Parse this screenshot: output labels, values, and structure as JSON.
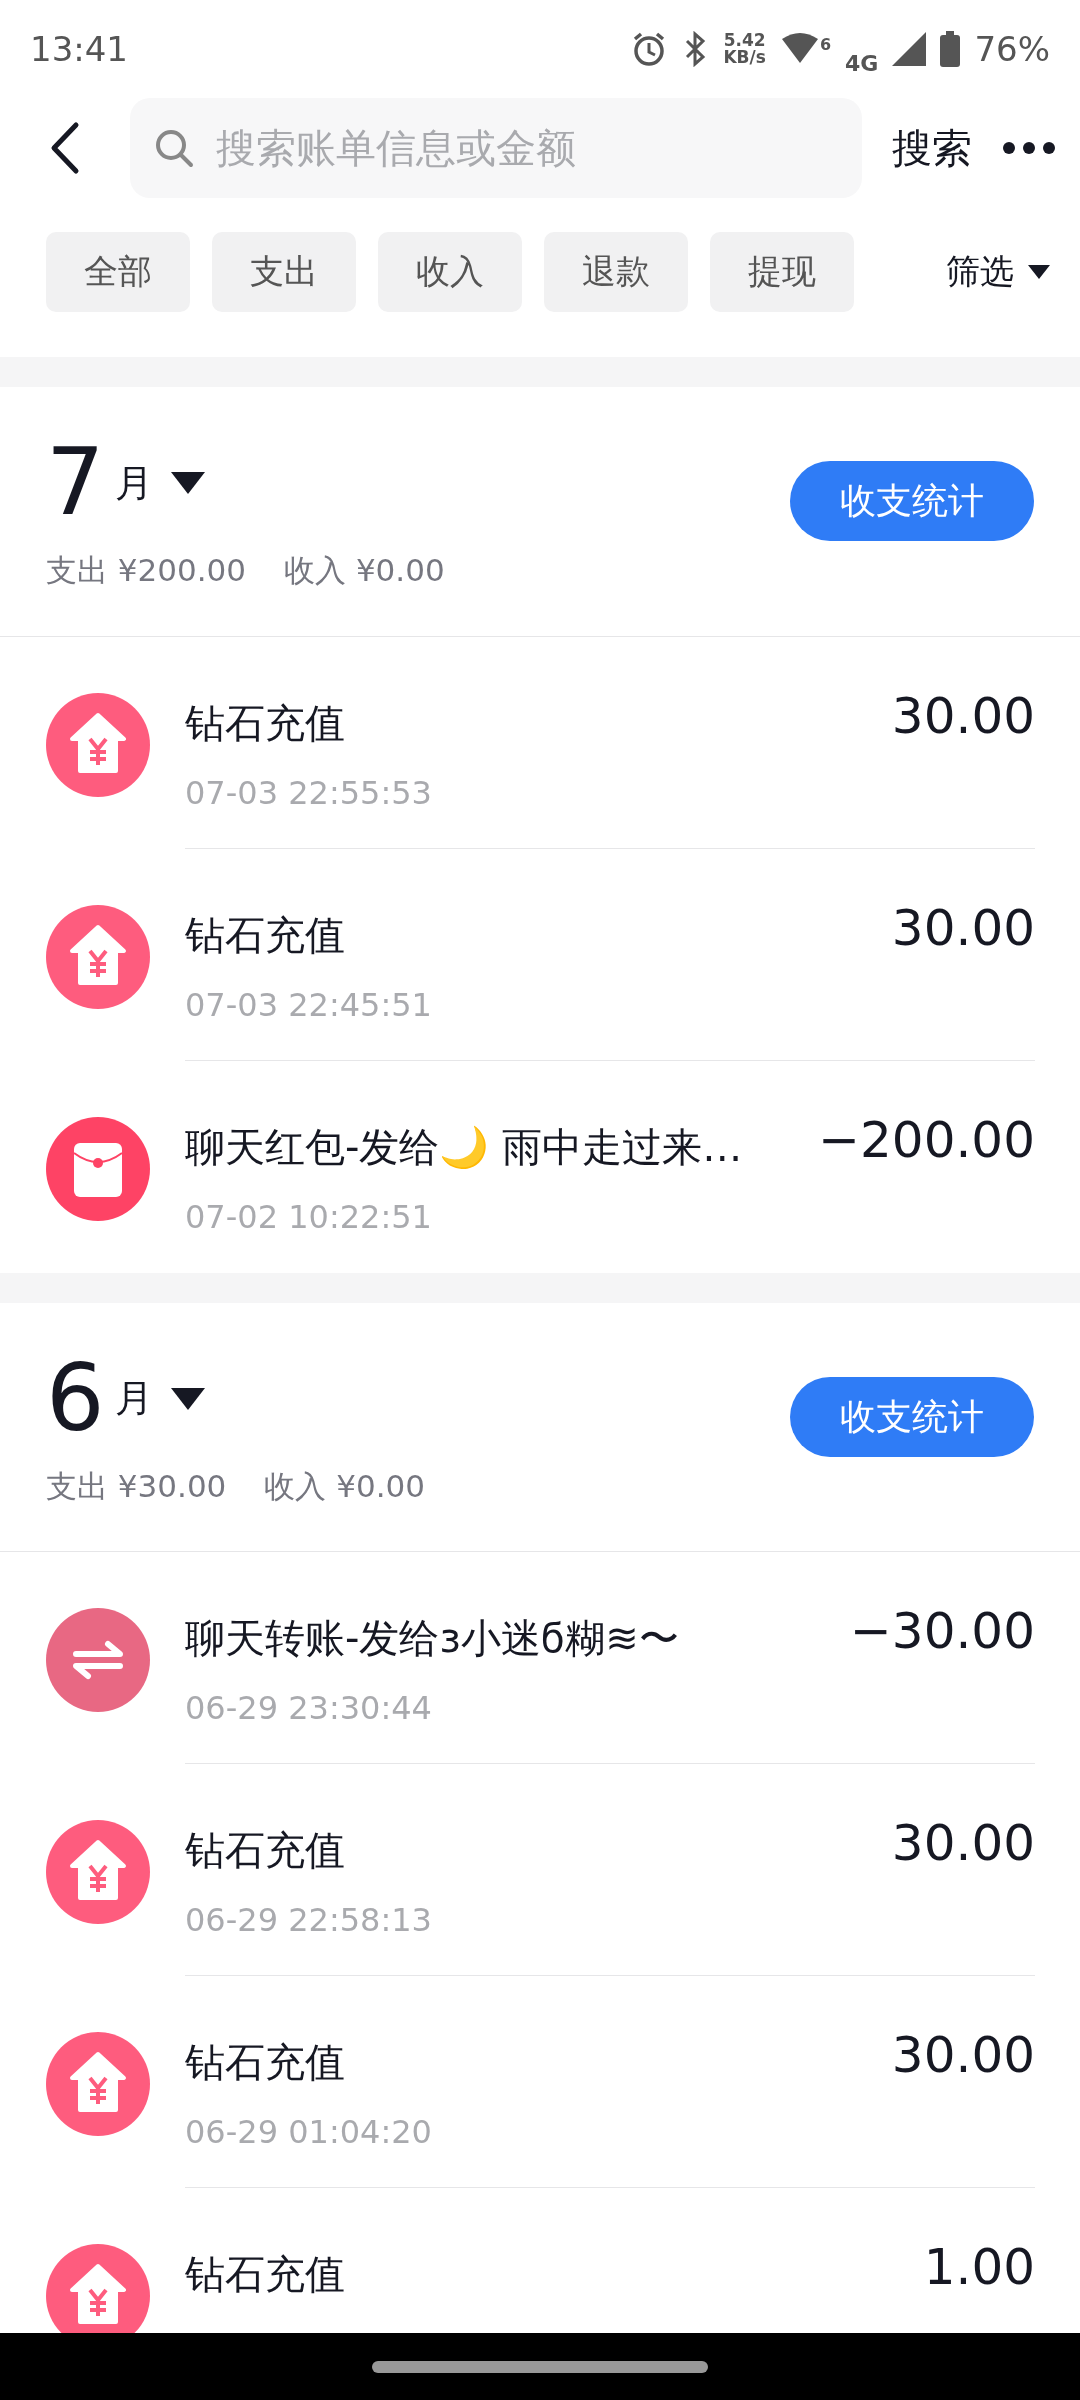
{
  "status_bar": {
    "time": "13:41",
    "speed": "5.42",
    "speed_unit": "KB/s",
    "wifi_badge": "6",
    "network": "4G",
    "battery": "76%"
  },
  "header": {
    "search": {
      "placeholder": "搜索账单信息或金额"
    },
    "search_button": "搜索"
  },
  "filters": [
    {
      "label": "全部"
    },
    {
      "label": "支出"
    },
    {
      "label": "收入"
    },
    {
      "label": "退款"
    },
    {
      "label": "提现"
    }
  ],
  "filter_menu": "筛选",
  "months": [
    {
      "number": "7",
      "unit": "月",
      "summary_out": "支出 ¥200.00",
      "summary_in": "收入 ¥0.00",
      "stats_button": "收支统计",
      "items": [
        {
          "kind": "recharge",
          "title": "钻石充值",
          "time": "07-03 22:55:53",
          "amount": "30.00"
        },
        {
          "kind": "recharge",
          "title": "钻石充值",
          "time": "07-03 22:45:51",
          "amount": "30.00"
        },
        {
          "kind": "red_packet",
          "title": "聊天红包-发给🌙 雨中走过来…",
          "time": "07-02 10:22:51",
          "amount": "−200.00"
        }
      ]
    },
    {
      "number": "6",
      "unit": "月",
      "summary_out": "支出 ¥30.00",
      "summary_in": "收入 ¥0.00",
      "stats_button": "收支统计",
      "items": [
        {
          "kind": "transfer",
          "title": "聊天转账-发给ɜ小迷ϭ糊≋〜",
          "time": "06-29 23:30:44",
          "amount": "−30.00"
        },
        {
          "kind": "recharge",
          "title": "钻石充值",
          "time": "06-29 22:58:13",
          "amount": "30.00"
        },
        {
          "kind": "recharge",
          "title": "钻石充值",
          "time": "06-29 01:04:20",
          "amount": "30.00"
        },
        {
          "kind": "recharge",
          "title": "钻石充值",
          "amount": "1.00"
        }
      ]
    }
  ]
}
